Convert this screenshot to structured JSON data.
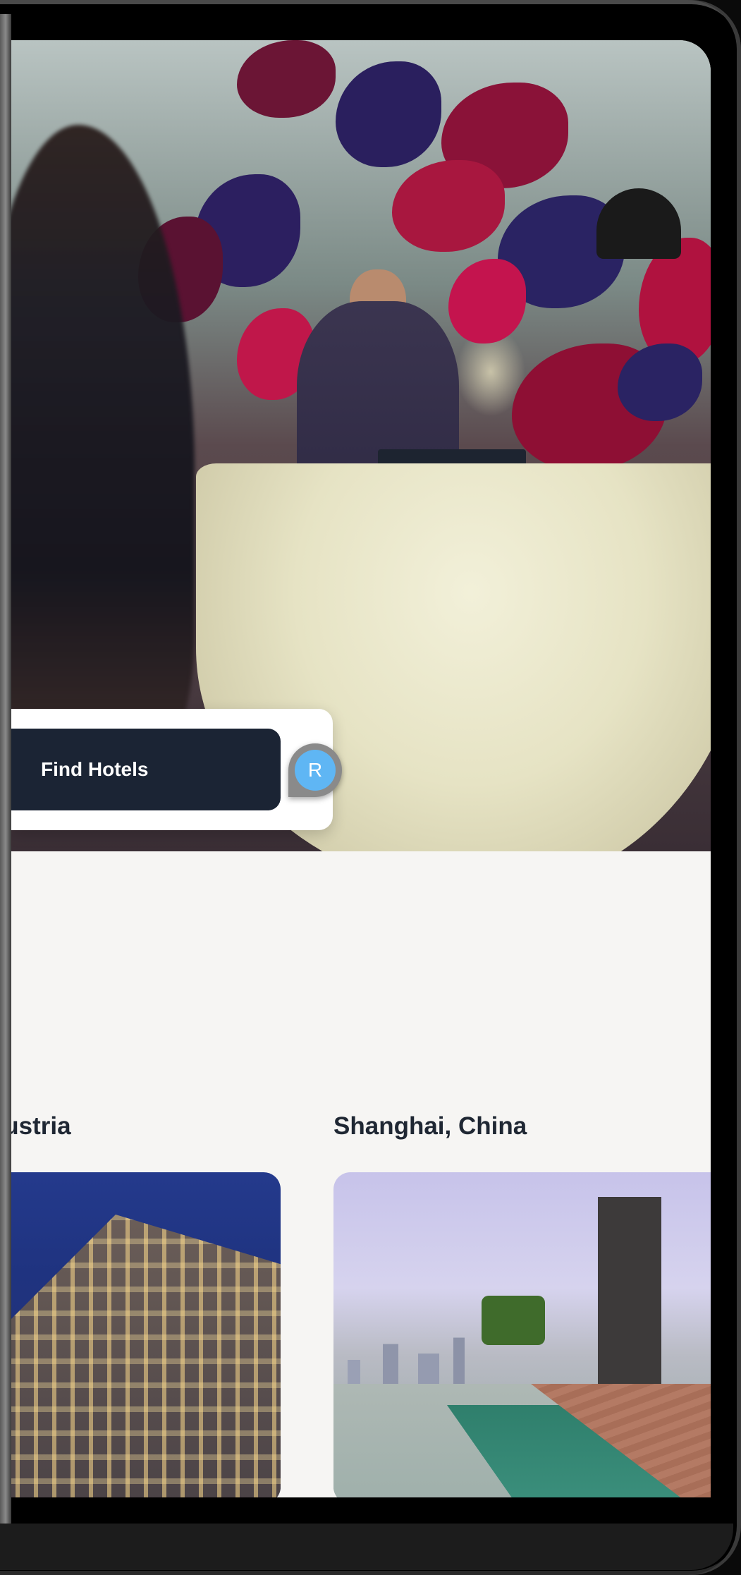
{
  "search": {
    "button_label": "Find Hotels",
    "avatar_initial": "R"
  },
  "destinations": [
    {
      "label": "Austria",
      "image": "vienna-hotel-building-night"
    },
    {
      "label": "Shanghai, China",
      "image": "rooftop-pool-city-skyline"
    }
  ],
  "colors": {
    "button_bg": "#1b2434",
    "avatar_bg": "#5fb6f4",
    "page_bg": "#f6f5f3",
    "heading_text": "#1f2733"
  }
}
